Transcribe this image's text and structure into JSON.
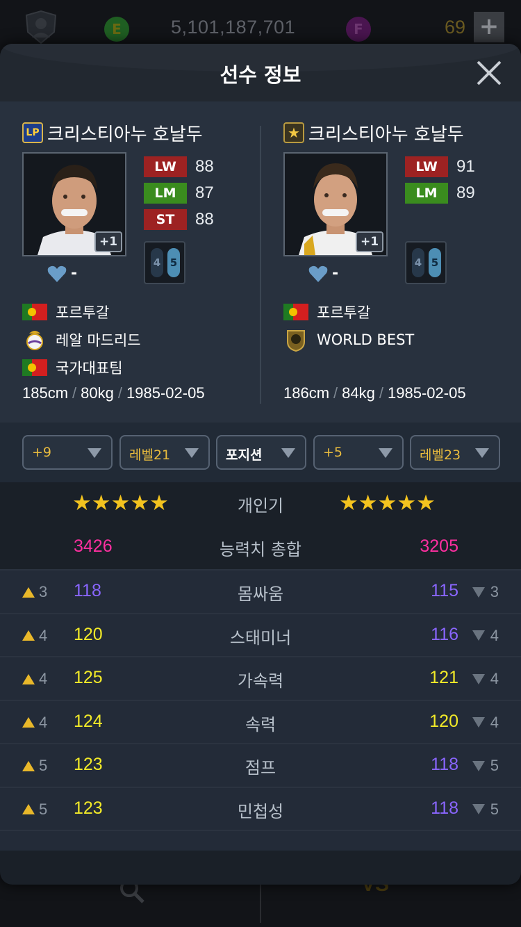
{
  "topbar": {
    "coin_e": "E",
    "money": "5,101,187,701",
    "coin_f": "F",
    "count": "69",
    "plus": "+"
  },
  "modal": {
    "title": "선수 정보",
    "close": "×"
  },
  "players": {
    "left": {
      "badge": "LP",
      "name": "크리스티아누 호날두",
      "plus": "+1",
      "likes": "-",
      "positions": [
        {
          "pos": "LW",
          "val": "88",
          "color": "red"
        },
        {
          "pos": "LM",
          "val": "87",
          "color": "green"
        },
        {
          "pos": "ST",
          "val": "88",
          "color": "red"
        }
      ],
      "foot_weak": "4",
      "foot_strong": "5",
      "nation": "포르투갈",
      "club": "레알 마드리드",
      "team": "국가대표팀",
      "height": "185cm",
      "weight": "80kg",
      "birth": "1985-02-05"
    },
    "right": {
      "badge": "★",
      "name": "크리스티아누 호날두",
      "plus": "+1",
      "likes": "-",
      "positions": [
        {
          "pos": "LW",
          "val": "91",
          "color": "red"
        },
        {
          "pos": "LM",
          "val": "89",
          "color": "green"
        }
      ],
      "foot_weak": "4",
      "foot_strong": "5",
      "nation": "포르투갈",
      "club": "WORLD BEST",
      "height": "186cm",
      "weight": "84kg",
      "birth": "1985-02-05"
    }
  },
  "dropdowns": [
    {
      "label": "+9",
      "style": "gold"
    },
    {
      "label": "레벨21",
      "style": "gold"
    },
    {
      "label": "포지션",
      "style": "white"
    },
    {
      "label": "+5",
      "style": "gold"
    },
    {
      "label": "레벨23",
      "style": "gold"
    }
  ],
  "popularity": {
    "label": "개인기",
    "left_stars": "★★★★★",
    "right_stars": "★★★★★"
  },
  "overall": {
    "label": "능력치 총합",
    "left": "3426",
    "right": "3205"
  },
  "stats": [
    {
      "name": "몸싸움",
      "left": "118",
      "left_color": "purple",
      "up": "3",
      "right": "115",
      "right_color": "purple",
      "down": "3"
    },
    {
      "name": "스태미너",
      "left": "120",
      "left_color": "yellow",
      "up": "4",
      "right": "116",
      "right_color": "purple",
      "down": "4"
    },
    {
      "name": "가속력",
      "left": "125",
      "left_color": "yellow",
      "up": "4",
      "right": "121",
      "right_color": "yellow",
      "down": "4"
    },
    {
      "name": "속력",
      "left": "124",
      "left_color": "yellow",
      "up": "4",
      "right": "120",
      "right_color": "yellow",
      "down": "4"
    },
    {
      "name": "점프",
      "left": "123",
      "left_color": "yellow",
      "up": "5",
      "right": "118",
      "right_color": "purple",
      "down": "5"
    },
    {
      "name": "민첩성",
      "left": "123",
      "left_color": "yellow",
      "up": "5",
      "right": "118",
      "right_color": "purple",
      "down": "5"
    }
  ],
  "bottomnav": {
    "vs_label": "VS"
  }
}
